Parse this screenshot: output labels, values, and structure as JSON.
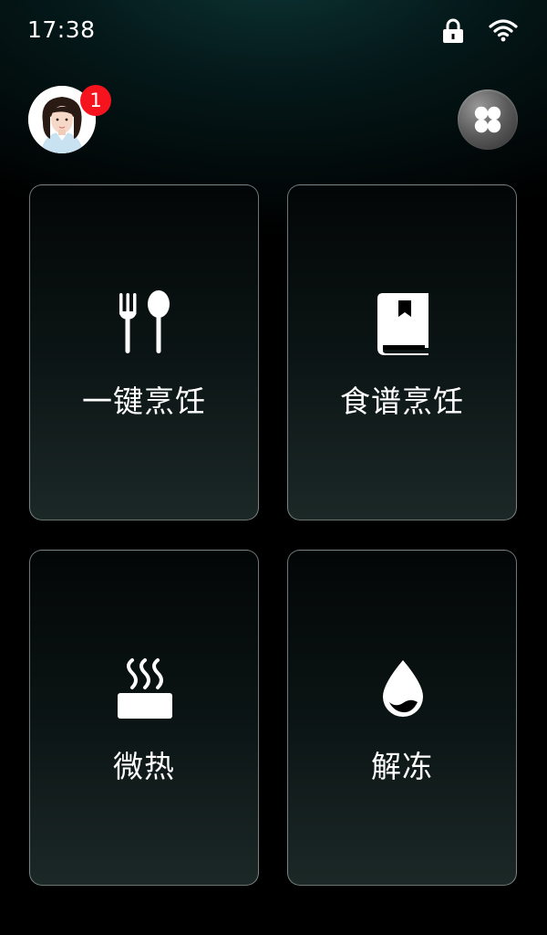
{
  "status_bar": {
    "time": "17:38",
    "icons": [
      "lock-icon",
      "wifi-icon"
    ]
  },
  "header": {
    "avatar": "user-avatar",
    "notification_count": "1",
    "menu_icon": "four-petal-menu-icon"
  },
  "cards": [
    {
      "label": "一键烹饪",
      "icon": "fork-spoon-icon"
    },
    {
      "label": "食谱烹饪",
      "icon": "recipe-book-icon"
    },
    {
      "label": "微热",
      "icon": "steam-heat-icon"
    },
    {
      "label": "解冻",
      "icon": "water-drop-icon"
    }
  ],
  "colors": {
    "badge": "#f5141e",
    "card_border": "#c8d2d2",
    "text": "#ffffff"
  }
}
